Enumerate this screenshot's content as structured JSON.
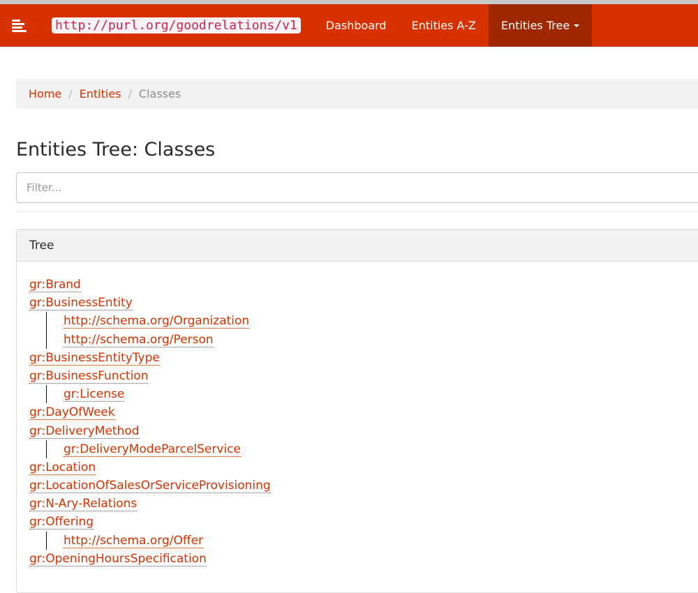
{
  "navbar": {
    "menu_icon": "align-left-icon",
    "brand": "http://purl.org/goodrelations/v1",
    "links": [
      {
        "label": "Dashboard",
        "active": false
      },
      {
        "label": "Entities A-Z",
        "active": false
      },
      {
        "label": "Entities Tree",
        "active": true,
        "dropdown": true
      }
    ],
    "accent_color": "#d83100",
    "active_color": "#9e2700"
  },
  "breadcrumb": {
    "items": [
      {
        "label": "Home",
        "link": true
      },
      {
        "label": "Entities",
        "link": true
      },
      {
        "label": "Classes",
        "link": false
      }
    ],
    "separator": "/"
  },
  "page": {
    "title": "Entities Tree: Classes",
    "filter": {
      "placeholder": "Filter...",
      "value": ""
    }
  },
  "tree_panel": {
    "heading": "Tree",
    "items": [
      {
        "label": "gr:Brand",
        "level": 0
      },
      {
        "label": "gr:BusinessEntity",
        "level": 0
      },
      {
        "label": "http://schema.org/Organization",
        "level": 1
      },
      {
        "label": "http://schema.org/Person",
        "level": 1
      },
      {
        "label": "gr:BusinessEntityType",
        "level": 0
      },
      {
        "label": "gr:BusinessFunction",
        "level": 0
      },
      {
        "label": "gr:License",
        "level": 1
      },
      {
        "label": "gr:DayOfWeek",
        "level": 0
      },
      {
        "label": "gr:DeliveryMethod",
        "level": 0
      },
      {
        "label": "gr:DeliveryModeParcelService",
        "level": 1
      },
      {
        "label": "gr:Location",
        "level": 0
      },
      {
        "label": "gr:LocationOfSalesOrServiceProvisioning",
        "level": 0
      },
      {
        "label": "gr:N-Ary-Relations",
        "level": 0
      },
      {
        "label": "gr:Offering",
        "level": 0
      },
      {
        "label": "http://schema.org/Offer",
        "level": 1
      },
      {
        "label": "gr:OpeningHoursSpecification",
        "level": 0
      }
    ]
  }
}
